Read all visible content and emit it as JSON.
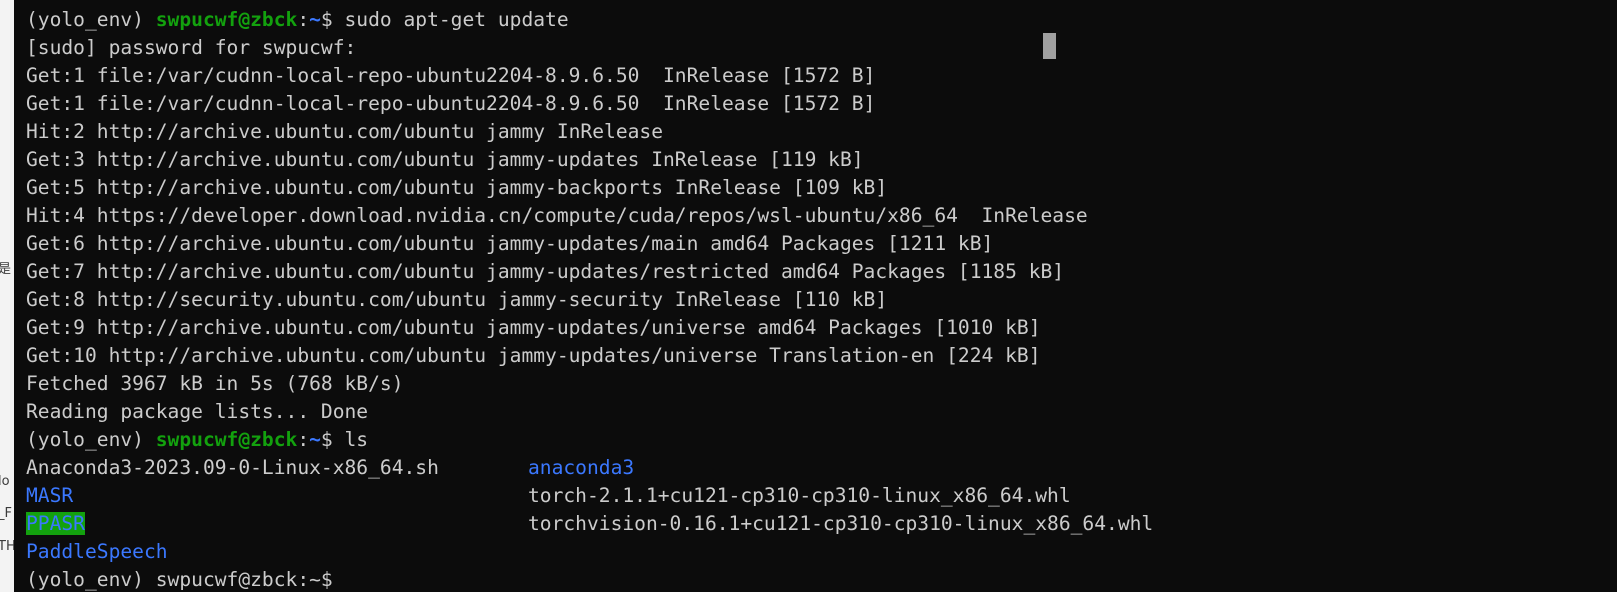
{
  "terminal": {
    "lines": [
      {
        "kind": "prompt",
        "env": "(yolo_env) ",
        "user": "swpucwf@zbck",
        "colon": ":",
        "path": "~",
        "symbol": "$ ",
        "command": "sudo apt-get update"
      },
      {
        "kind": "text",
        "text": "[sudo] password for swpucwf:"
      },
      {
        "kind": "text",
        "text": "Get:1 file:/var/cudnn-local-repo-ubuntu2204-8.9.6.50  InRelease [1572 B]"
      },
      {
        "kind": "text",
        "text": "Get:1 file:/var/cudnn-local-repo-ubuntu2204-8.9.6.50  InRelease [1572 B]"
      },
      {
        "kind": "text",
        "text": "Hit:2 http://archive.ubuntu.com/ubuntu jammy InRelease"
      },
      {
        "kind": "text",
        "text": "Get:3 http://archive.ubuntu.com/ubuntu jammy-updates InRelease [119 kB]"
      },
      {
        "kind": "text",
        "text": "Get:5 http://archive.ubuntu.com/ubuntu jammy-backports InRelease [109 kB]"
      },
      {
        "kind": "text",
        "text": "Hit:4 https://developer.download.nvidia.cn/compute/cuda/repos/wsl-ubuntu/x86_64  InRelease"
      },
      {
        "kind": "text",
        "text": "Get:6 http://archive.ubuntu.com/ubuntu jammy-updates/main amd64 Packages [1211 kB]"
      },
      {
        "kind": "text",
        "text": "Get:7 http://archive.ubuntu.com/ubuntu jammy-updates/restricted amd64 Packages [1185 kB]"
      },
      {
        "kind": "text",
        "text": "Get:8 http://security.ubuntu.com/ubuntu jammy-security InRelease [110 kB]"
      },
      {
        "kind": "text",
        "text": "Get:9 http://archive.ubuntu.com/ubuntu jammy-updates/universe amd64 Packages [1010 kB]"
      },
      {
        "kind": "text",
        "text": "Get:10 http://archive.ubuntu.com/ubuntu jammy-updates/universe Translation-en [224 kB]"
      },
      {
        "kind": "text",
        "text": "Fetched 3967 kB in 5s (768 kB/s)"
      },
      {
        "kind": "text",
        "text": "Reading package lists... Done"
      },
      {
        "kind": "prompt",
        "env": "(yolo_env) ",
        "user": "swpucwf@zbck",
        "colon": ":",
        "path": "~",
        "symbol": "$ ",
        "command": "ls"
      }
    ],
    "ls_rows": [
      {
        "left": "Anaconda3-2023.09-0-Linux-x86_64.sh",
        "left_type": "file",
        "right": "anaconda3",
        "right_type": "dir"
      },
      {
        "left": "MASR",
        "left_type": "dir",
        "right": "torch-2.1.1+cu121-cp310-cp310-linux_x86_64.whl",
        "right_type": "file"
      },
      {
        "left": "PPASR",
        "left_type": "dir-highlight",
        "right": "torchvision-0.16.1+cu121-cp310-cp310-linux_x86_64.whl",
        "right_type": "file"
      },
      {
        "left": "PaddleSpeech",
        "left_type": "dir",
        "right": "",
        "right_type": "file"
      }
    ],
    "cut_prompt": "(yolo_env) swpucwf@zbck:~$",
    "colors": {
      "background": "#0c0c0c",
      "foreground": "#cccccc",
      "user": "#13a10e",
      "path": "#3b78ff",
      "dir": "#3b78ff",
      "highlight_bg": "#13a10e"
    }
  },
  "side_strip": {
    "fragments": [
      "是",
      "lo",
      "_F",
      "TH"
    ]
  }
}
